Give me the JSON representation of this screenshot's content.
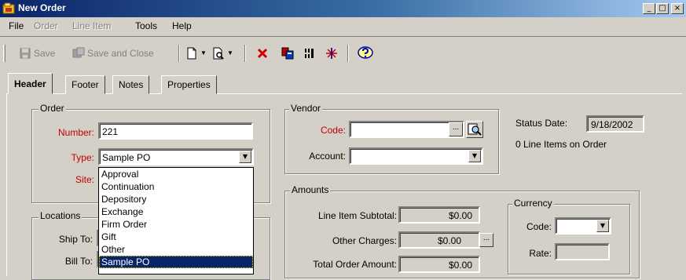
{
  "window": {
    "title": "New Order",
    "minimize": "_",
    "restore": "□",
    "close": "×"
  },
  "menu": [
    "File",
    "Order",
    "Line Item",
    "Tools",
    "Help"
  ],
  "toolbar": {
    "save_label": "Save",
    "save_close_label": "Save and Close"
  },
  "tabs": [
    "Header",
    "Footer",
    "Notes",
    "Properties"
  ],
  "order": {
    "group_label": "Order",
    "number_label": "Number:",
    "number_value": "221",
    "type_label": "Type:",
    "type_value": "Sample PO",
    "site_label": "Site:",
    "type_options": [
      "Approval",
      "Continuation",
      "Depository",
      "Exchange",
      "Firm Order",
      "Gift",
      "Other",
      "Sample PO"
    ]
  },
  "locations": {
    "group_label": "Locations",
    "ship_to_label": "Ship To:",
    "bill_to_label": "Bill To:"
  },
  "vendor": {
    "group_label": "Vendor",
    "code_label": "Code:",
    "code_value": "",
    "ellipsis": "...",
    "account_label": "Account:",
    "account_value": ""
  },
  "status": {
    "date_label": "Status Date:",
    "date_value": "9/18/2002",
    "line_items_text": "0 Line Items on Order"
  },
  "amounts": {
    "group_label": "Amounts",
    "subtotal_label": "Line Item Subtotal:",
    "subtotal_value": "$0.00",
    "other_label": "Other Charges:",
    "other_value": "$0.00",
    "ellipsis": "...",
    "total_label": "Total Order Amount:",
    "total_value": "$0.00"
  },
  "currency": {
    "group_label": "Currency",
    "code_label": "Code:",
    "code_value": "",
    "rate_label": "Rate:",
    "rate_value": ""
  },
  "colors": {
    "title_bar": "#0a246a",
    "required_label": "#c00000",
    "selection": "#0a246a",
    "face": "#d4d0c8"
  }
}
